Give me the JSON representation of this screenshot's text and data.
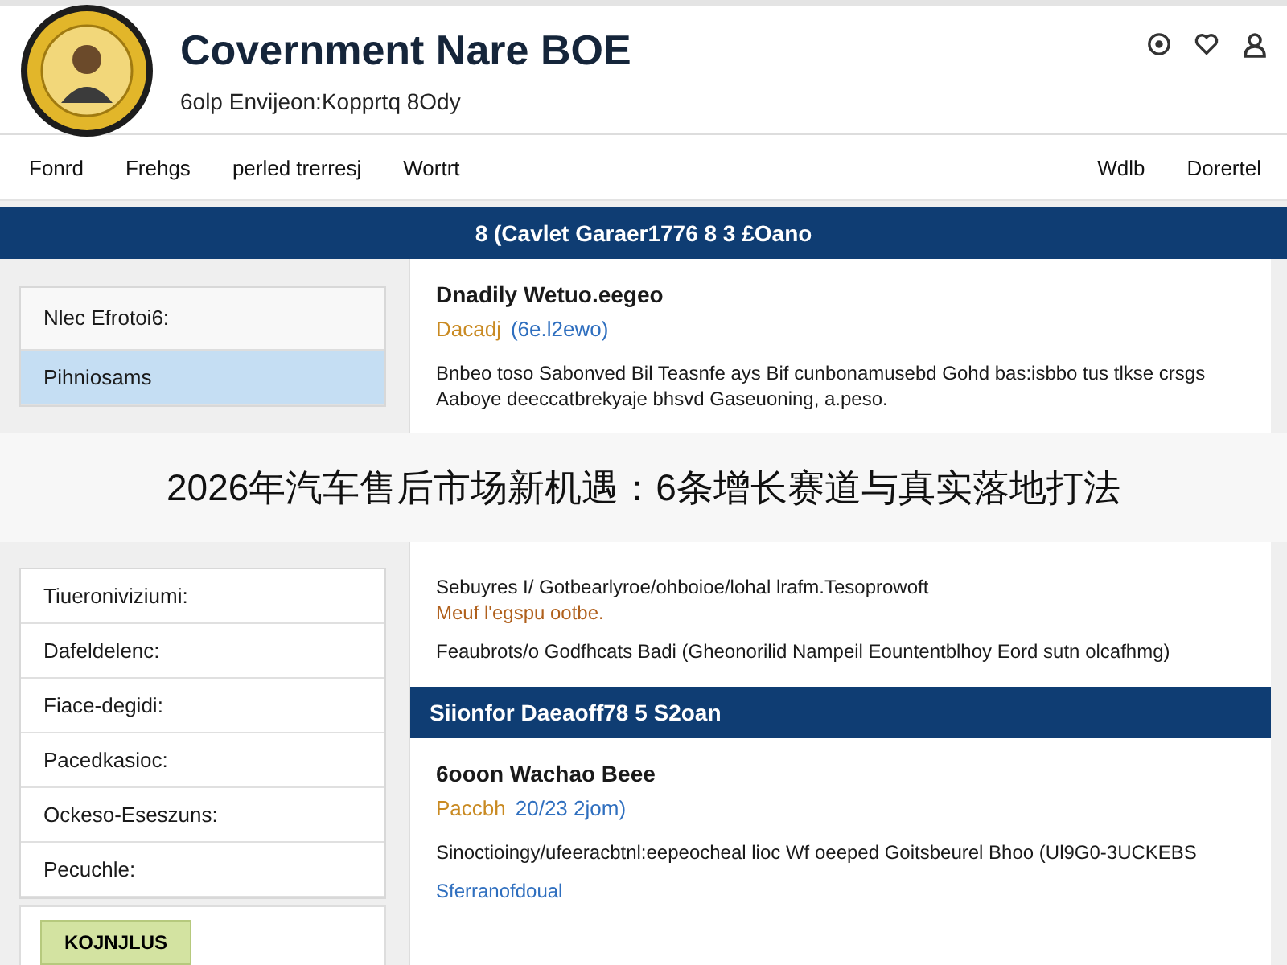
{
  "header": {
    "title": "Covernment Nare BOE",
    "subtitle": "6olp Envijeon:Kopprtq 8Ody"
  },
  "nav": {
    "left": [
      "Fonrd",
      "Frehgs",
      "perled trerresj",
      "Wortrt"
    ],
    "right": [
      "Wdlb",
      "Dorertel"
    ]
  },
  "band": "8 (Cavlet Garaer1776 8 3 £Oano",
  "sidebar": {
    "heading": "Nlec Efrotoi6:",
    "items": [
      {
        "label": "Pihniosams",
        "selected": true
      },
      {
        "label": "Tiueroniviziumi:",
        "selected": false
      },
      {
        "label": "Dafeldelenc:",
        "selected": false
      },
      {
        "label": "Fiace-degidi:",
        "selected": false
      },
      {
        "label": "Pacedkasioc:",
        "selected": false
      },
      {
        "label": "Ockeso-Eseszuns:",
        "selected": false
      },
      {
        "label": "Pecuchle:",
        "selected": false
      }
    ],
    "button": "KOJNJLUS"
  },
  "article": {
    "title": "Dnadily Wetuo.eegeo",
    "date": "Dacadj",
    "ref": "(6e.l2ewo)",
    "text": "Bnbeo toso Sabonved Bil Teasnfe ays Bif cunbonamusebd Gohd bas:isbbo tus tlkse crsgs Aaboye deeccatbrekyaje bhsvd Gaseuoning, a.peso."
  },
  "overlay": "2026年汽车售后市场新机遇：6条增长赛道与真实落地打法",
  "paragraphs": [
    {
      "text": "Sebuyres I/ Gotbearlyroe/ohboioe/lohal lrafm.Tesoprowoft",
      "kind": "plain"
    },
    {
      "text": "Meuf l'egspu ootbe.",
      "kind": "accent"
    },
    {
      "text": "Feaubrots/o Godfhcats Badi (Gheonorilid Nampeil Eountentblhoy Eord sutn olcafhmg)",
      "kind": "plain"
    }
  ],
  "section": {
    "heading": "Siionfor Daeaoff78 5 S2oan",
    "title": "6ooon Wachao Beee",
    "date": "Paccbh",
    "ref": "20/23 2jom)",
    "paragraphs": [
      {
        "text": "Sinoctioingy/ufeeracbtnl:eepeocheal lioc Wf oeeped Goitsbeurel Bhoo (Ul9G0-3UCKEBS",
        "kind": "plain"
      },
      {
        "text": "Sferranofdoual",
        "kind": "link"
      }
    ]
  }
}
